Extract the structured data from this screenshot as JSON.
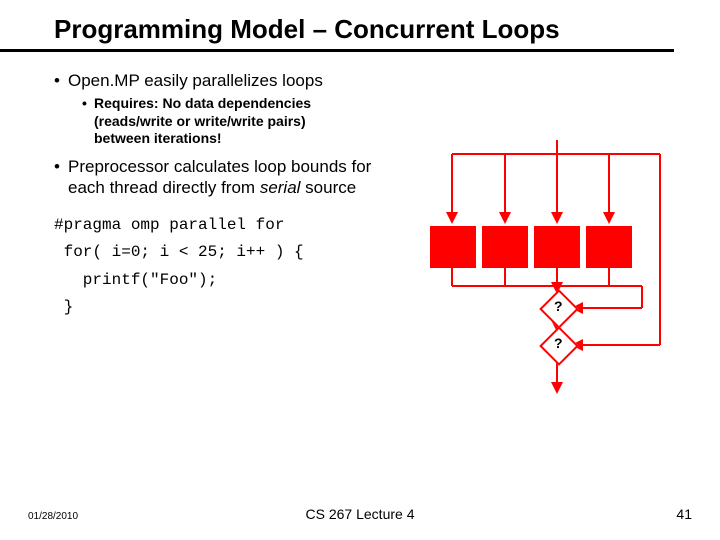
{
  "title": "Programming Model – Concurrent Loops",
  "bullets": {
    "b1": "Open.MP easily parallelizes loops",
    "b2": "Requires: No data dependencies (reads/write or write/write pairs) between iterations!",
    "b3_pre": "Preprocessor calculates loop bounds for each thread directly from ",
    "b3_it": "serial",
    "b3_post": " source"
  },
  "code": {
    "l1": "#pragma omp parallel for",
    "l2": " for( i=0; i < 25; i++ ) {",
    "l3": "   printf(\"Foo\");",
    "l4": " }"
  },
  "diagram": {
    "q1": "?",
    "q2": "?"
  },
  "footer": {
    "date": "01/28/2010",
    "center": "CS 267 Lecture 4",
    "page": "41"
  }
}
